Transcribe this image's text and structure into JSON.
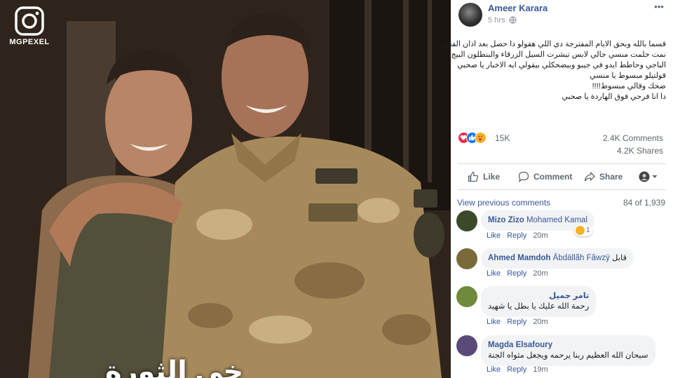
{
  "photo": {
    "watermark": "MGPEXEL",
    "banner_text": "خي الثورة"
  },
  "post": {
    "author": "Ameer Karara",
    "time": "5 hrs",
    "text_lines": [
      "قسما بالله وبحق الايام المفترجة دي اللي هقولو دا حصل بعد اذان الفجر",
      "نمت حلمت منسي جالي لابس تيشرت السيل الزرقاء والبنطلون البيج",
      "الباجي وحاطط ايدو في جيبو وبيضحكلي بيقولي ايه الاخبار يا صحبي",
      "قولتيلو مبسوط يا منسي",
      "ضحك وقالي مبسوط!!!!",
      "دا انا فرحي فوق الهاردة يا صحبي"
    ],
    "reaction_count": "15K",
    "comment_count": "2.4K Comments",
    "share_count": "4.2K Shares"
  },
  "actions": {
    "like": "Like",
    "comment": "Comment",
    "share": "Share"
  },
  "comments_header": {
    "view_previous": "View previous comments",
    "count": "84 of 1,939"
  },
  "comments": [
    {
      "name": "Mizo Zizo",
      "tag": "Mohamed Kamal",
      "text": "",
      "like": "Like",
      "reply": "Reply",
      "time": "20m",
      "reaction_count": "1",
      "avatar_color": "#3a4a28"
    },
    {
      "name": "Ahmed Mamdoh",
      "tag": "Äbdällãh Fâwzÿ",
      "text": "قابل",
      "like": "Like",
      "reply": "Reply",
      "time": "20m",
      "avatar_color": "#7a6a3a"
    },
    {
      "name": "تامر جميل",
      "tag": "",
      "text": "رحمة الله عليك يا بطل يا شهيد",
      "like": "Like",
      "reply": "Reply",
      "time": "20m",
      "avatar_color": "#6e8a3a"
    },
    {
      "name": "Magda Elsafoury",
      "tag": "",
      "text": "سبحان الله العظيم ربنا يرحمه ويجعل مثواه الجنة",
      "like": "Like",
      "reply": "Reply",
      "time": "19m",
      "avatar_color": "#5a4a7a"
    }
  ],
  "colors": {
    "link_blue": "#385898",
    "meta_gray": "#606770",
    "bubble_bg": "#f2f3f5",
    "love_red": "#f0284a",
    "like_blue": "#1877f2",
    "care_yellow": "#f7b125"
  }
}
